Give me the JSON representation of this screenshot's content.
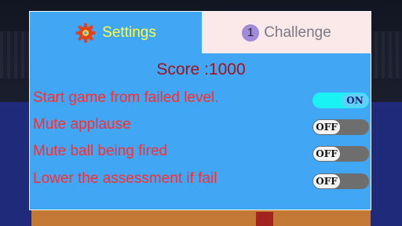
{
  "tabs": {
    "settings": {
      "label": "Settings",
      "icon": "gear-icon",
      "active": true
    },
    "challenge": {
      "label": "Challenge",
      "badge": "1",
      "active": false
    }
  },
  "score": {
    "label": "Score :1000"
  },
  "options": [
    {
      "label": "Start game from failed level.",
      "state": "ON"
    },
    {
      "label": "Mute applause",
      "state": "OFF"
    },
    {
      "label": "Mute ball being fired",
      "state": "OFF"
    },
    {
      "label": "Lower the assessment if fail",
      "state": "OFF"
    }
  ],
  "colors": {
    "panel": "#41a6f4",
    "settings_text": "#ffff3c",
    "option_text": "#ff2c2c",
    "score_text": "#a3121c",
    "toggle_on": "#19f3f3",
    "toggle_off": "#6e6e6e"
  }
}
